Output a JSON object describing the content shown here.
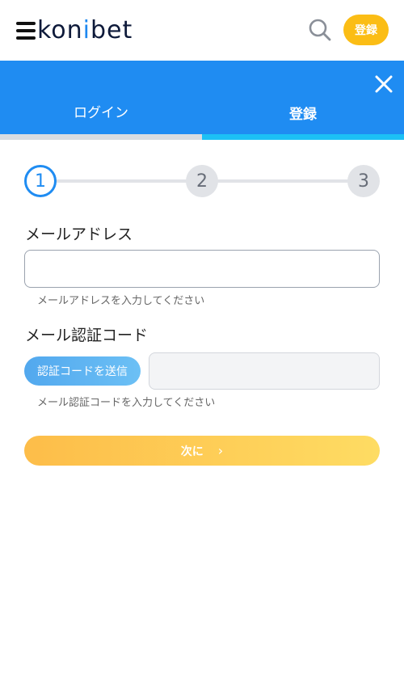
{
  "header": {
    "logo_text_dark": "kon",
    "logo_text_accent": "i",
    "logo_text_rest": "bet",
    "register_label": "登録",
    "icons": {
      "menu": "hamburger-menu-icon",
      "search": "search-icon"
    }
  },
  "tabs": [
    {
      "label": "ログイン"
    },
    {
      "label": "登録"
    }
  ],
  "close_icon": "close-icon",
  "stepper": {
    "steps": [
      "1",
      "2",
      "3"
    ],
    "current": 1
  },
  "form": {
    "email_label": "メールアドレス",
    "email_value": "",
    "email_hint": "メールアドレスを入力してください",
    "code_label": "メール認証コード",
    "send_code_label": "認証コードを送信",
    "code_value": "",
    "code_hint": "メール認証コードを入力してください",
    "next_label": "次に",
    "next_chevron": "›"
  },
  "colors": {
    "primary_blue": "#1f8cf2",
    "accent_cyan": "#1cc0f5",
    "accent_yellow": "#fbbd15"
  }
}
